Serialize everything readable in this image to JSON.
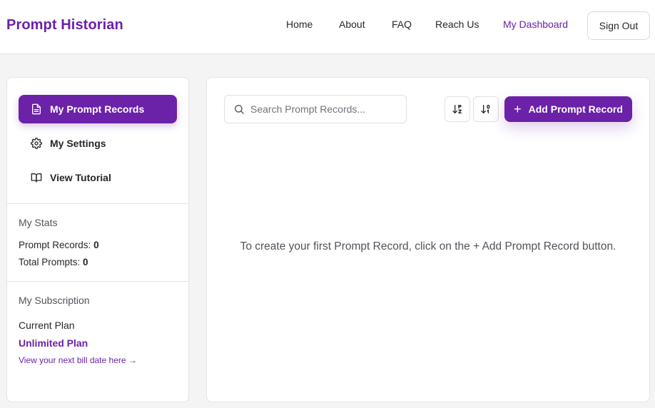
{
  "header": {
    "brand": "Prompt Historian",
    "nav": [
      "Home",
      "About",
      "FAQ",
      "Reach Us",
      "My Dashboard"
    ],
    "sign_out": "Sign Out"
  },
  "sidebar": {
    "items": [
      {
        "label": "My Prompt Records",
        "icon": "document-icon",
        "active": true
      },
      {
        "label": "My Settings",
        "icon": "gear-icon",
        "active": false
      },
      {
        "label": "View Tutorial",
        "icon": "book-icon",
        "active": false
      }
    ],
    "stats": {
      "title": "My Stats",
      "prompt_records_label": "Prompt Records:",
      "prompt_records_value": "0",
      "total_prompts_label": "Total Prompts:",
      "total_prompts_value": "0"
    },
    "subscription": {
      "title": "My Subscription",
      "current_plan_label": "Current Plan",
      "plan_name": "Unlimited Plan",
      "bill_link": "View your next bill date here →"
    }
  },
  "main": {
    "search_placeholder": "Search Prompt Records...",
    "add_button": "Add Prompt Record",
    "empty_message": "To create your first Prompt Record, click on the + Add Prompt Record button."
  },
  "colors": {
    "accent": "#6b21a8",
    "background": "#f4f4f5"
  }
}
